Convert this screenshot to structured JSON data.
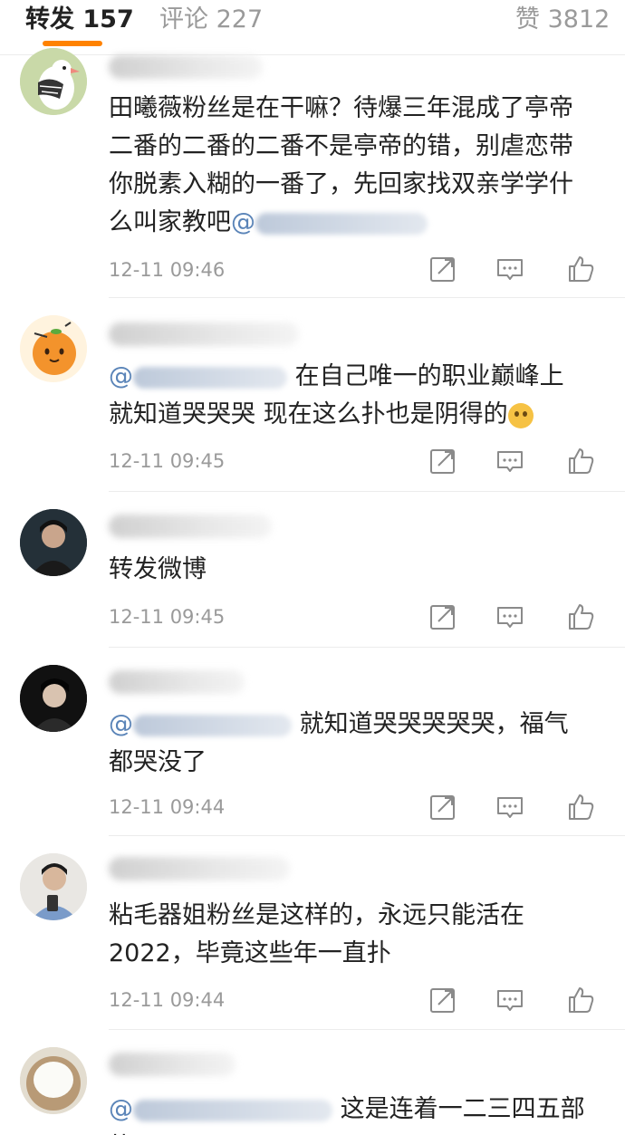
{
  "tabs": {
    "reposts": "转发 157",
    "comments": "评论 227",
    "likes": "赞 3812"
  },
  "colors": {
    "accent": "#ff8200",
    "mention": "#5a84b8",
    "text": "#222222",
    "muted": "#9a9a9a"
  },
  "comments": [
    {
      "text_lines": [
        "田曦薇粉丝是在干嘛？待爆三年混成了亭帝",
        "二番的二番的二番不是亭帝的错，别虐恋带",
        "你脱素入糊的一番了，先回家找双亲学学什"
      ],
      "line4_prefix": "么叫家教吧",
      "line4_mention": "@",
      "time": "12-11 09:46"
    },
    {
      "mention": "@",
      "line1_text": "在自己唯一的职业巅峰上",
      "line2_text": "就知道哭哭哭 现在这么扑也是阴得的",
      "time": "12-11 09:45"
    },
    {
      "text": "转发微博",
      "time": "12-11 09:45"
    },
    {
      "mention": "@",
      "line1_text": "就知道哭哭哭哭哭，福气",
      "line2_text": "都哭没了",
      "time": "12-11 09:44"
    },
    {
      "line1_text": "粘毛器姐粉丝是这样的，永远只能活在",
      "line2_text": "2022，毕竟这些年一直扑",
      "time": "12-11 09:44"
    },
    {
      "mention": "@",
      "line1_text": "这是连着一二三四五部扑"
    }
  ]
}
